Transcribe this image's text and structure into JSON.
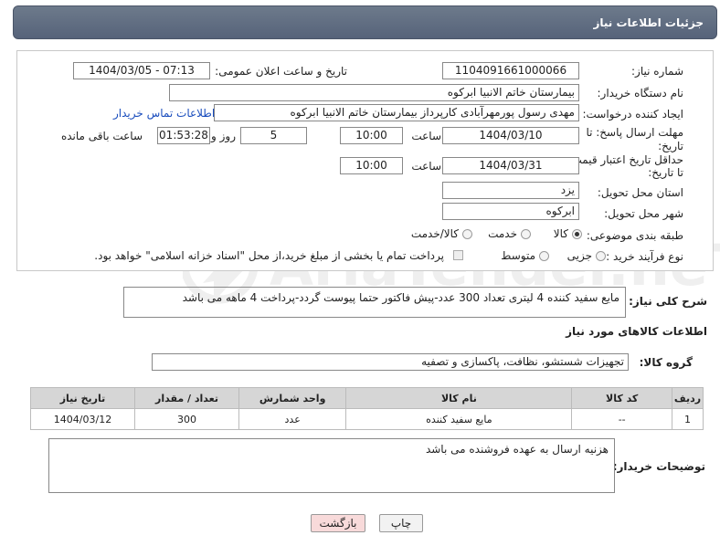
{
  "header": {
    "title": "جزئیات اطلاعات نیاز"
  },
  "form": {
    "need_number_label": "شماره نیاز:",
    "need_number": "1104091661000066",
    "announce_label": "تاریخ و ساعت اعلان عمومی:",
    "announce_value": "1404/03/05 - 07:13",
    "buyer_org_label": "نام دستگاه خریدار:",
    "buyer_org": "بیمارستان خاتم الانبیا ابرکوه",
    "creator_label": "ایجاد کننده درخواست:",
    "creator": "مهدی رسول پورمهرآبادی کارپرداز بیمارستان خاتم الانبیا ابرکوه",
    "contact_link": "اطلاعات تماس خریدار",
    "reply_deadline_label_1": "مهلت ارسال پاسخ: تا",
    "reply_deadline_label_2": "تاریخ:",
    "reply_date": "1404/03/10",
    "time_label": "ساعت",
    "reply_time": "10:00",
    "days_value": "5",
    "days_label": "روز و",
    "remaining_time": "01:53:28",
    "remaining_label": "ساعت باقی مانده",
    "price_deadline_label_1": "حداقل تاریخ اعتبار قیمت:",
    "price_deadline_label_2": "تا تاریخ:",
    "price_date": "1404/03/31",
    "price_time": "10:00",
    "province_label": "استان محل تحویل:",
    "province": "یزد",
    "city_label": "شهر محل تحویل:",
    "city": "ابرکوه",
    "category_label": "طبقه بندی موضوعی:",
    "category_options": [
      "کالا",
      "خدمت",
      "کالا/خدمت"
    ],
    "purchase_type_label": "نوع فرآیند خرید :",
    "purchase_options": [
      "جزیی",
      "متوسط"
    ],
    "payment_note": "پرداخت تمام یا بخشی از مبلغ خرید،از محل \"اسناد خزانه اسلامی\" خواهد بود."
  },
  "description": {
    "label": "شرح کلی نیاز:",
    "text": "مایع سفید کننده 4 لیتری تعداد 300 عدد-پیش فاکتور حتما پیوست گردد-پرداخت 4 ماهه می باشد"
  },
  "goods": {
    "section_title": "اطلاعات کالاهای مورد نیاز",
    "group_label": "گروه کالا:",
    "group_value": "تجهیزات شستشو، نظافت، پاکسازی و تصفیه",
    "columns": [
      "ردیف",
      "کد کالا",
      "نام کالا",
      "واحد شمارش",
      "تعداد / مقدار",
      "تاریخ نیاز"
    ],
    "rows": [
      {
        "row": "1",
        "code": "--",
        "name": "مایع سفید کننده",
        "unit": "عدد",
        "qty": "300",
        "date": "1404/03/12"
      }
    ]
  },
  "buyer_notes": {
    "label": "توضیحات خریدار:",
    "text": "هزنیه ارسال به عهده فروشنده می باشد"
  },
  "buttons": {
    "print": "چاپ",
    "back": "بازگشت"
  },
  "watermark": {
    "text": "AriaTender.neT"
  },
  "colors": {
    "header_bg": "#5e6b80",
    "link": "#1a4dbd",
    "back_button_bg": "#f8dada"
  }
}
